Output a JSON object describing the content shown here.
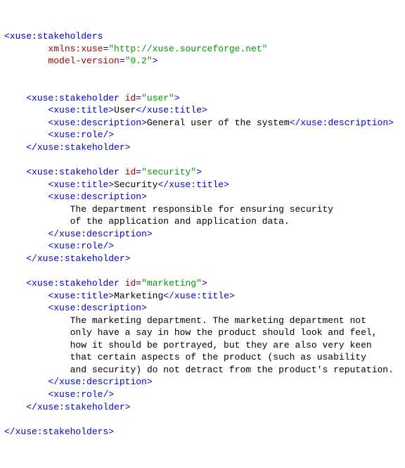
{
  "root": {
    "name": "xuse:stakeholders",
    "attrs": {
      "xmlns_name": "xmlns:xuse",
      "xmlns_val": "\"http://xuse.sourceforge.net\"",
      "mv_name": "model-version",
      "mv_val": "\"0.2\""
    }
  },
  "s1": {
    "open": "xuse:stakeholder",
    "id_name": "id",
    "id_val": "\"user\"",
    "title_tag": "xuse:title",
    "title_text": "User",
    "desc_tag": "xuse:description",
    "desc_text": "General user of the system",
    "role_tag": "xuse:role",
    "close": "xuse:stakeholder"
  },
  "s2": {
    "open": "xuse:stakeholder",
    "id_name": "id",
    "id_val": "\"security\"",
    "title_tag": "xuse:title",
    "title_text": "Security",
    "desc_tag": "xuse:description",
    "desc_l1": "The department responsible for ensuring security",
    "desc_l2": "of the application and application data.",
    "role_tag": "xuse:role",
    "close": "xuse:stakeholder"
  },
  "s3": {
    "open": "xuse:stakeholder",
    "id_name": "id",
    "id_val": "\"marketing\"",
    "title_tag": "xuse:title",
    "title_text": "Marketing",
    "desc_tag": "xuse:description",
    "desc_l1": "The marketing department. The marketing department not",
    "desc_l2": "only have a say in how the product should look and feel,",
    "desc_l3": "how it should be portrayed, but they are also very keen",
    "desc_l4": "that certain aspects of the product (such as usability",
    "desc_l5": "and security) do not detract from the product's reputation.",
    "role_tag": "xuse:role",
    "close": "xuse:stakeholder"
  }
}
